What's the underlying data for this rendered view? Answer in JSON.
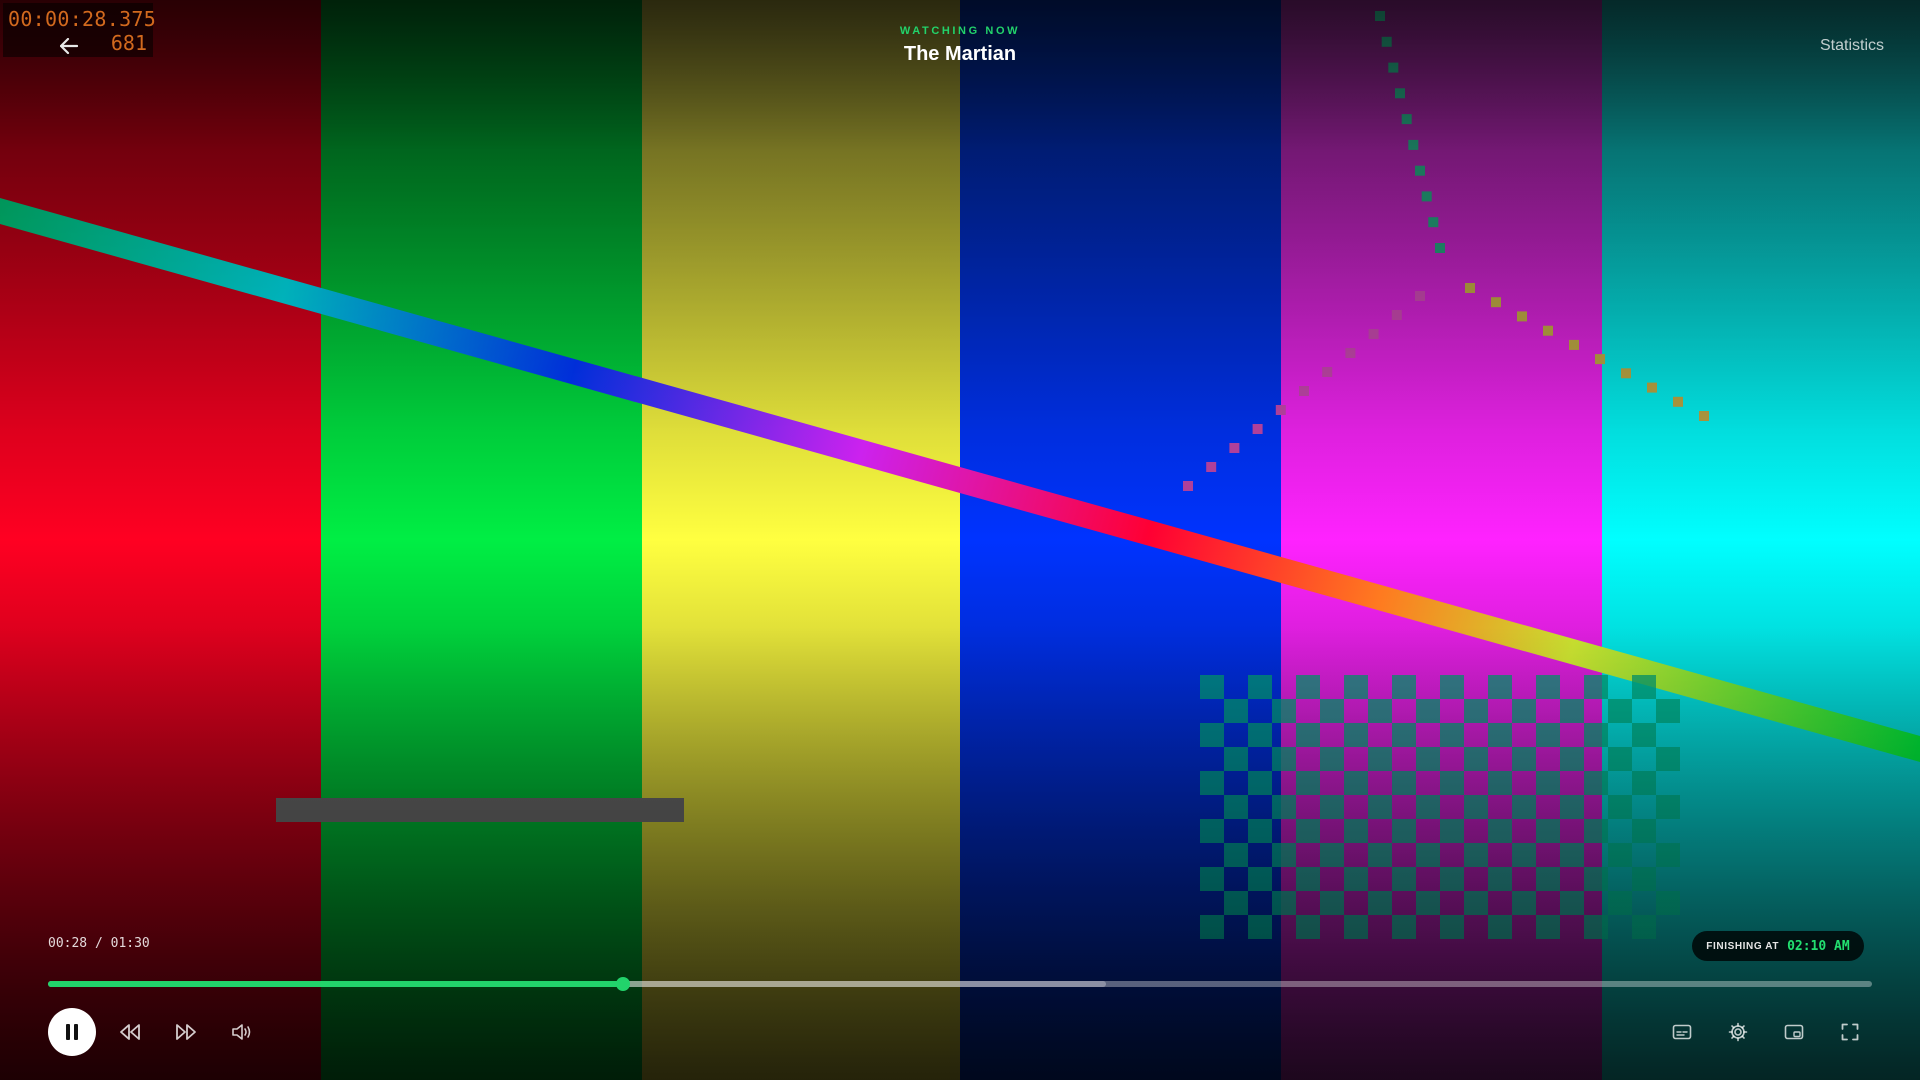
{
  "debug_overlay": {
    "timecode": "00:00:28.375",
    "frame": "681"
  },
  "header": {
    "eyebrow": "WATCHING NOW",
    "title": "The Martian",
    "stats_label": "Statistics"
  },
  "player": {
    "time_display": "00:28 / 01:30",
    "progress": 0.315,
    "buffered": 0.58,
    "finishing_label": "FINISHING AT",
    "finishing_time": "02:10 AM"
  },
  "controls": {
    "left": [
      "pause-icon",
      "rewind-icon",
      "fast-forward-icon",
      "volume-icon"
    ],
    "right": [
      "subtitles-icon",
      "settings-icon",
      "picture-in-picture-icon",
      "fullscreen-icon"
    ]
  },
  "test_pattern": {
    "bar_colors": [
      "#ff0022",
      "#00ee44",
      "#ffff40",
      "#0033ff",
      "#ff22ff",
      "#00ffff"
    ],
    "accent": "#22d36b"
  }
}
